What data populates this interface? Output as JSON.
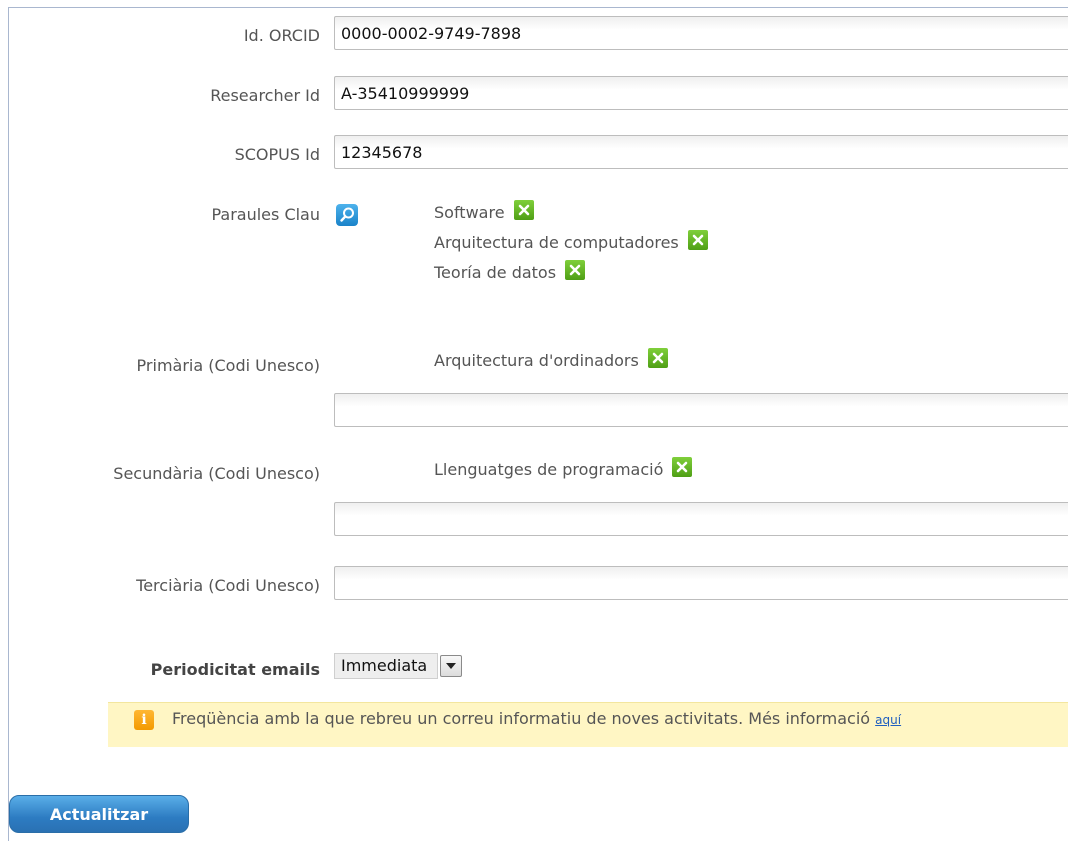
{
  "fields": {
    "orcid": {
      "label": "Id. ORCID",
      "value": "0000-0002-9749-7898"
    },
    "researcher": {
      "label": "Researcher Id",
      "value": "A-35410999999"
    },
    "scopus": {
      "label": "SCOPUS Id",
      "value": "12345678"
    }
  },
  "keywords": {
    "label": "Paraules Clau",
    "search_icon": "search-icon",
    "items": [
      {
        "label": "Software"
      },
      {
        "label": "Arquitectura de computadores"
      },
      {
        "label": "Teoría de datos"
      }
    ]
  },
  "unesco": {
    "primary": {
      "label": "Primària (Codi Unesco)",
      "tag": "Arquitectura d'ordinadors",
      "value": ""
    },
    "secondary": {
      "label": "Secundària (Codi Unesco)",
      "tag": "Llenguatges de programació",
      "value": ""
    },
    "tertiary": {
      "label": "Terciària (Codi Unesco)",
      "value": ""
    }
  },
  "email_frequency": {
    "label": "Periodicitat emails",
    "selected": "Immediata"
  },
  "info": {
    "icon": "info-icon",
    "text": "Freqüència amb la que rebreu un correu informatiu de noves activitats. Més informació",
    "link": "aquí"
  },
  "actions": {
    "update_label": "Actualitzar"
  },
  "colors": {
    "remove_tag": "#5fb223",
    "search_button": "#1f8ad6",
    "info_background": "#fff6c4",
    "update_button": "#2d7cc2"
  }
}
